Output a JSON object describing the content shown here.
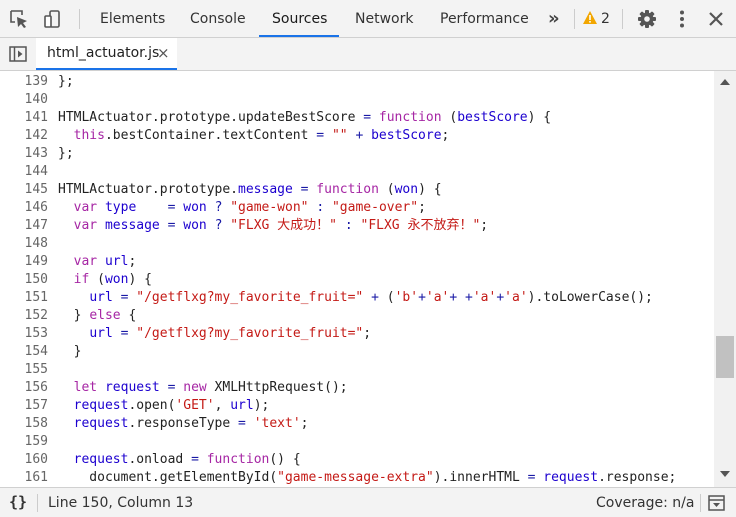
{
  "toolbar": {
    "tabs": [
      "Elements",
      "Console",
      "Sources",
      "Network",
      "Performance"
    ],
    "selected_tab": "Sources",
    "more_label": "»",
    "warning_count": "2"
  },
  "file_tabs": [
    {
      "label": "html_actuator.js",
      "close": "×"
    }
  ],
  "editor": {
    "lines": [
      {
        "n": "139",
        "code": "};"
      },
      {
        "n": "140",
        "code": ""
      },
      {
        "n": "141",
        "code": "HTMLActuator.prototype.updateBestScore = function (bestScore) {"
      },
      {
        "n": "142",
        "code": "  this.bestContainer.textContent = \"\" + bestScore;"
      },
      {
        "n": "143",
        "code": "};"
      },
      {
        "n": "144",
        "code": ""
      },
      {
        "n": "145",
        "code": "HTMLActuator.prototype.message = function (won) {"
      },
      {
        "n": "146",
        "code": "  var type    = won ? \"game-won\" : \"game-over\";"
      },
      {
        "n": "147",
        "code": "  var message = won ? \"FLXG 大成功！\" : \"FLXG 永不放弃！\";"
      },
      {
        "n": "148",
        "code": ""
      },
      {
        "n": "149",
        "code": "  var url;"
      },
      {
        "n": "150",
        "code": "  if (won) {"
      },
      {
        "n": "151",
        "code": "    url = \"/getflxg?my_favorite_fruit=\" + ('b'+'a'+ +'a'+'a').toLowerCase();"
      },
      {
        "n": "152",
        "code": "  } else {"
      },
      {
        "n": "153",
        "code": "    url = \"/getflxg?my_favorite_fruit=\";"
      },
      {
        "n": "154",
        "code": "  }"
      },
      {
        "n": "155",
        "code": ""
      },
      {
        "n": "156",
        "code": "  let request = new XMLHttpRequest();"
      },
      {
        "n": "157",
        "code": "  request.open('GET', url);"
      },
      {
        "n": "158",
        "code": "  request.responseType = 'text';"
      },
      {
        "n": "159",
        "code": ""
      },
      {
        "n": "160",
        "code": "  request.onload = function() {"
      },
      {
        "n": "161",
        "code": "    document.getElementById(\"game-message-extra\").innerHTML = request.response;"
      }
    ]
  },
  "status": {
    "pretty_print": "{}",
    "position": "Line 150, Column 13",
    "coverage": "Coverage: n/a"
  },
  "icons": [
    "inspect-element-icon",
    "device-toolbar-icon",
    "warning-icon",
    "settings-gear-icon",
    "more-vert-icon",
    "close-icon",
    "toggle-navigator-icon",
    "toggle-drawer-icon"
  ],
  "colors": {
    "accent": "#1a73e8",
    "keyword": "#a626a4",
    "string": "#c41a16",
    "variable": "#1c00cf",
    "warning": "#f2a600"
  }
}
